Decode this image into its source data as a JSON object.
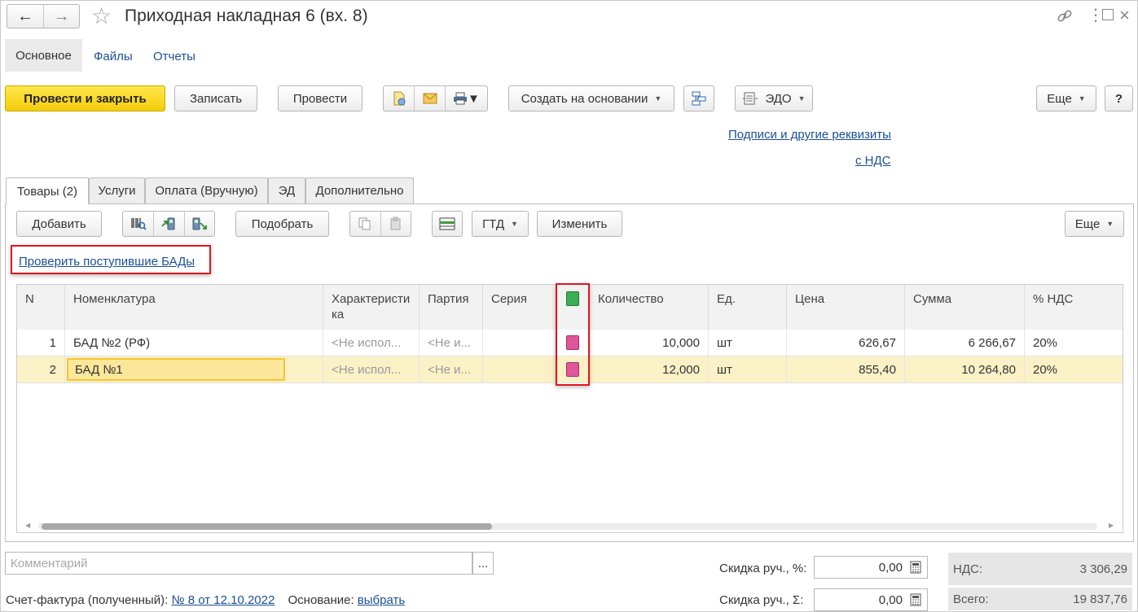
{
  "window": {
    "title": "Приходная накладная 6 (вх. 8)"
  },
  "nav_tabs": [
    {
      "label": "Основное"
    },
    {
      "label": "Файлы"
    },
    {
      "label": "Отчеты"
    }
  ],
  "toolbar": {
    "post_close": "Провести и закрыть",
    "save": "Записать",
    "post": "Провести",
    "create_based": "Создать на основании",
    "edo": "ЭДО",
    "more": "Еще",
    "help": "?"
  },
  "links": {
    "signatures": "Подписи и другие реквизиты",
    "vat": "с НДС",
    "check_bads": "Проверить поступившие БАДы"
  },
  "tabs": [
    {
      "label": "Товары (2)"
    },
    {
      "label": "Услуги"
    },
    {
      "label": "Оплата (Вручную)"
    },
    {
      "label": "ЭД"
    },
    {
      "label": "Дополнительно"
    }
  ],
  "goods_toolbar": {
    "add": "Добавить",
    "pick": "Подобрать",
    "gtd": "ГТД",
    "change": "Изменить",
    "more": "Еще"
  },
  "table": {
    "columns": {
      "n": "N",
      "item": "Номенклатура",
      "char": "Характеристика",
      "batch": "Партия",
      "series": "Серия",
      "qty": "Количество",
      "unit": "Ед.",
      "price": "Цена",
      "sum": "Сумма",
      "vat": "% НДС"
    },
    "rows": [
      {
        "n": "1",
        "item": "БАД №2 (РФ)",
        "char": "<Не испол...",
        "batch": "<Не и...",
        "series": "",
        "qty": "10,000",
        "unit": "шт",
        "price": "626,67",
        "sum": "6 266,67",
        "vat": "20%"
      },
      {
        "n": "2",
        "item": "БАД №1",
        "char": "<Не испол...",
        "batch": "<Не и...",
        "series": "",
        "qty": "12,000",
        "unit": "шт",
        "price": "855,40",
        "sum": "10 264,80",
        "vat": "20%"
      }
    ]
  },
  "footer": {
    "comment_placeholder": "Комментарий",
    "comment_button": "...",
    "discount_pct_label": "Скидка руч., %:",
    "discount_pct_value": "0,00",
    "discount_sum_label": "Скидка руч., Σ:",
    "discount_sum_value": "0,00",
    "vat_label": "НДС:",
    "vat_value": "3 306,29",
    "total_label": "Всего:",
    "total_value": "19 837,76",
    "invoice_label": "Счет-фактура (полученный):",
    "invoice_link": "№ 8 от 12.10.2022",
    "basis_label": "Основание:",
    "basis_link": "выбрать"
  },
  "colors": {
    "accent_yellow": "#f4cc0b",
    "link_blue": "#1b4f94",
    "highlight_red": "#e0141e",
    "selected_row": "#fbf1c7"
  }
}
